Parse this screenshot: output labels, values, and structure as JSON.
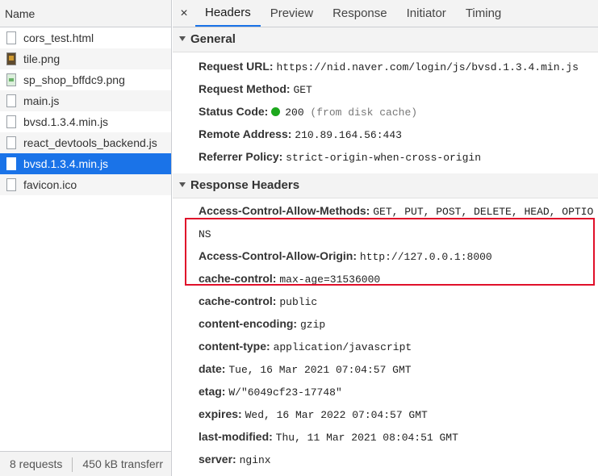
{
  "left": {
    "header": "Name",
    "files": [
      {
        "name": "cors_test.html",
        "icon": "document-icon"
      },
      {
        "name": "tile.png",
        "icon": "image-icon"
      },
      {
        "name": "sp_shop_bffdc9.png",
        "icon": "image-icon"
      },
      {
        "name": "main.js",
        "icon": "document-icon"
      },
      {
        "name": "bvsd.1.3.4.min.js",
        "icon": "document-icon"
      },
      {
        "name": "react_devtools_backend.js",
        "icon": "document-icon"
      },
      {
        "name": "bvsd.1.3.4.min.js",
        "icon": "document-icon",
        "selected": true
      },
      {
        "name": "favicon.ico",
        "icon": "document-icon"
      }
    ],
    "footer": {
      "requests": "8 requests",
      "transferred": "450 kB transferr"
    }
  },
  "tabs": {
    "close": "×",
    "items": [
      "Headers",
      "Preview",
      "Response",
      "Initiator",
      "Timing"
    ],
    "active": "Headers"
  },
  "general": {
    "title": "General",
    "request_url_label": "Request URL:",
    "request_url": "https://nid.naver.com/login/js/bvsd.1.3.4.min.js",
    "request_method_label": "Request Method:",
    "request_method": "GET",
    "status_code_label": "Status Code:",
    "status_code": "200",
    "status_note": "(from disk cache)",
    "remote_address_label": "Remote Address:",
    "remote_address": "210.89.164.56:443",
    "referrer_policy_label": "Referrer Policy:",
    "referrer_policy": "strict-origin-when-cross-origin"
  },
  "response_headers": {
    "title": "Response Headers",
    "items": [
      {
        "k": "Access-Control-Allow-Methods:",
        "v": "GET, PUT, POST, DELETE, HEAD, OPTIONS"
      },
      {
        "k": "Access-Control-Allow-Origin:",
        "v": "http://127.0.0.1:8000"
      },
      {
        "k": "cache-control:",
        "v": "max-age=31536000"
      },
      {
        "k": "cache-control:",
        "v": "public"
      },
      {
        "k": "content-encoding:",
        "v": "gzip"
      },
      {
        "k": "content-type:",
        "v": "application/javascript"
      },
      {
        "k": "date:",
        "v": "Tue, 16 Mar 2021 07:04:57 GMT"
      },
      {
        "k": "etag:",
        "v": "W/\"6049cf23-17748\""
      },
      {
        "k": "expires:",
        "v": "Wed, 16 Mar 2022 07:04:57 GMT"
      },
      {
        "k": "last-modified:",
        "v": "Thu, 11 Mar 2021 08:04:51 GMT"
      },
      {
        "k": "server:",
        "v": "nginx"
      }
    ]
  },
  "colors": {
    "accent": "#1a73e8",
    "highlight_border": "#e0102a",
    "status_ok": "#1da81d"
  }
}
